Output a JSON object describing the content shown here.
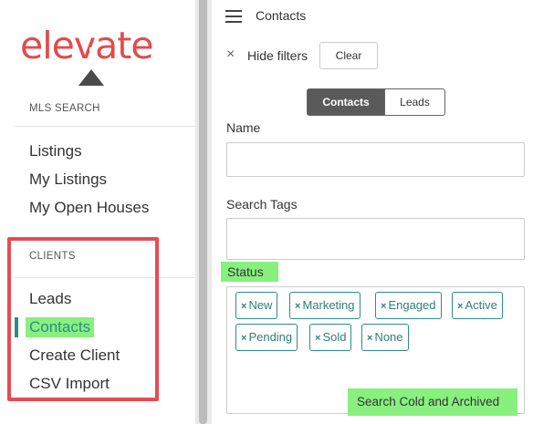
{
  "logo": {
    "text": "elevate"
  },
  "sidebar": {
    "mls_section_title": "MLS SEARCH",
    "mls_items": [
      "Listings",
      "My Listings",
      "My Open Houses"
    ],
    "clients_section_title": "CLIENTS",
    "clients_items": [
      "Leads",
      "Contacts",
      "Create Client",
      "CSV Import"
    ],
    "active_item": "Contacts"
  },
  "header": {
    "title": "Contacts"
  },
  "filters": {
    "close_icon": "×",
    "hide_label": "Hide filters",
    "clear_label": "Clear"
  },
  "toggle": {
    "contacts_label": "Contacts",
    "leads_label": "Leads",
    "selected": "Contacts"
  },
  "form": {
    "name_label": "Name",
    "name_value": "",
    "tags_label": "Search Tags",
    "tags_value": "",
    "status_label": "Status",
    "status_chips": [
      "New",
      "Marketing",
      "Engaged",
      "Active",
      "Pending",
      "Sold",
      "None"
    ],
    "chip_remove_glyph": "×",
    "search_cold_label": "Search Cold and Archived",
    "next_label_partial": "...."
  },
  "colors": {
    "brand": "#e34b4b",
    "accent": "#2d8c86",
    "highlight": "#88f07f",
    "annotation_red": "#e84b52"
  },
  "icons": {
    "menu": "hamburger-icon",
    "close": "close-icon",
    "logo_mark": "triangle-icon"
  }
}
